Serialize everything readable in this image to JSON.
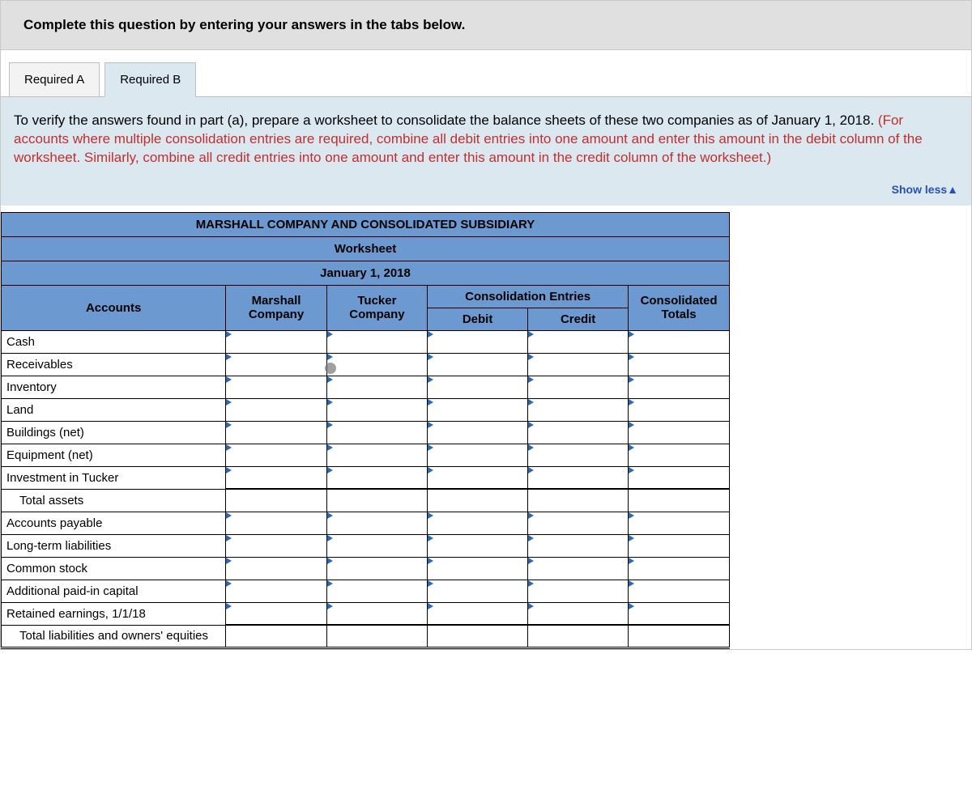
{
  "instruction": "Complete this question by entering your answers in the tabs below.",
  "tabs": {
    "a": "Required A",
    "b": "Required B"
  },
  "prompt": {
    "lead": "To verify the answers found in part (a), prepare a worksheet to consolidate the balance sheets of these two companies as of January 1, 2018. ",
    "red": "(For accounts where multiple consolidation entries are required, combine all debit entries into one amount and enter this amount in the debit column of the worksheet. Similarly, combine all credit entries into one amount and enter this amount in the credit column of the worksheet.)"
  },
  "showless": "Show less",
  "table": {
    "title": "MARSHALL COMPANY AND CONSOLIDATED SUBSIDIARY",
    "subtitle": "Worksheet",
    "date": "January 1, 2018",
    "headers": {
      "accounts": "Accounts",
      "marshall": "Marshall Company",
      "tucker": "Tucker Company",
      "consol_entries": "Consolidation Entries",
      "debit": "Debit",
      "credit": "Credit",
      "consol_totals": "Consolidated Totals"
    },
    "rows": [
      {
        "label": "Cash",
        "input": true
      },
      {
        "label": "Receivables",
        "input": true
      },
      {
        "label": "Inventory",
        "input": true
      },
      {
        "label": "Land",
        "input": true
      },
      {
        "label": "Buildings (net)",
        "input": true
      },
      {
        "label": "Equipment (net)",
        "input": true
      },
      {
        "label": "Investment in Tucker",
        "input": true
      },
      {
        "label": "Total assets",
        "input": false,
        "indent": true,
        "total": true
      },
      {
        "label": "Accounts payable",
        "input": true
      },
      {
        "label": "Long-term liabilities",
        "input": true
      },
      {
        "label": "Common stock",
        "input": true
      },
      {
        "label": "Additional paid-in capital",
        "input": true
      },
      {
        "label": "Retained earnings, 1/1/18",
        "input": true
      },
      {
        "label": "Total liabilities and owners' equities",
        "input": false,
        "indent": true,
        "total": true,
        "dbl": true
      }
    ]
  }
}
